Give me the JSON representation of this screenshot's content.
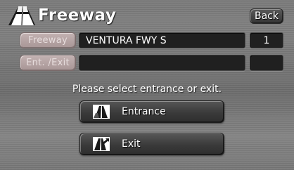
{
  "header": {
    "title": "Freeway",
    "title_icon": "road-icon",
    "back_label": "Back"
  },
  "rows": {
    "freeway": {
      "button_label": "Freeway",
      "name_value": "VENTURA FWY S",
      "number_value": "1"
    },
    "entrance_exit": {
      "button_label": "Ent. /Exit",
      "name_value": "",
      "number_value": ""
    }
  },
  "prompt": "Please select entrance or exit.",
  "actions": {
    "entrance": {
      "label": "Entrance",
      "icon": "freeway-entrance-icon"
    },
    "exit": {
      "label": "Exit",
      "icon": "freeway-exit-icon"
    }
  },
  "colors": {
    "background": "#7c7c7c",
    "disabled_button": "#b4a2a2",
    "field_background": "#202020",
    "button_dark": "#3a3a3a",
    "text": "#ffffff"
  }
}
